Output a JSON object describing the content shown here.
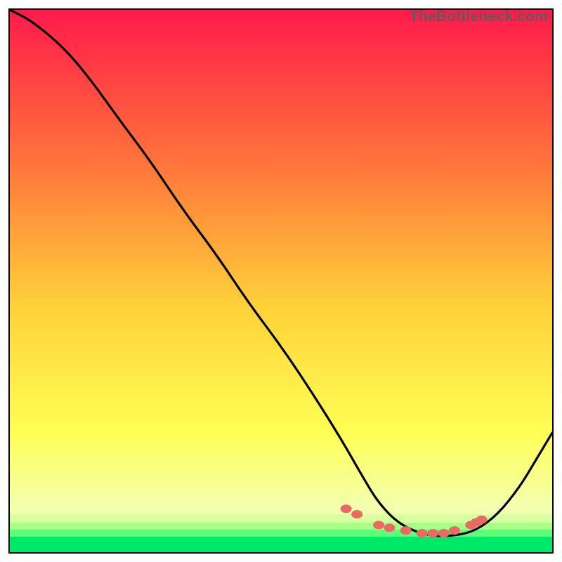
{
  "watermark": "TheBottleneck.com",
  "colors": {
    "top": "#ff1a4b",
    "mid1": "#ff7a3a",
    "mid2": "#ffd23a",
    "mid3": "#ffff55",
    "low": "#f3ffb0",
    "band1": "#d9ffa1",
    "band2": "#a8ff88",
    "band3": "#5cff78",
    "green": "#00e868",
    "frame": "#000000",
    "curve": "#000000",
    "dots": "#e96a63"
  },
  "chart_data": {
    "type": "line",
    "title": "",
    "xlabel": "",
    "ylabel": "",
    "xlim": [
      0,
      100
    ],
    "ylim": [
      0,
      100
    ],
    "description": "Bottleneck curve over a vertical red→yellow→green gradient; minimum (optimal) region highlighted with salmon dots along the trough.",
    "series": [
      {
        "name": "bottleneck-curve",
        "x": [
          0,
          4,
          10,
          15,
          20,
          26,
          32,
          38,
          44,
          50,
          56,
          61,
          65,
          68,
          72,
          77,
          82,
          86,
          90,
          94,
          97,
          100
        ],
        "y": [
          100,
          98,
          93,
          87,
          80,
          72,
          63,
          55,
          46,
          38,
          29,
          21,
          14,
          9,
          5,
          3,
          3,
          4,
          7,
          12,
          17,
          22
        ]
      }
    ],
    "optimal_markers": {
      "name": "optimal-dots",
      "x": [
        62,
        64,
        68,
        70,
        73,
        76,
        78,
        80,
        82,
        85,
        86,
        87
      ],
      "y": [
        8,
        7,
        5,
        4.5,
        4,
        3.5,
        3.5,
        3.5,
        4,
        5,
        5.5,
        6
      ]
    }
  }
}
